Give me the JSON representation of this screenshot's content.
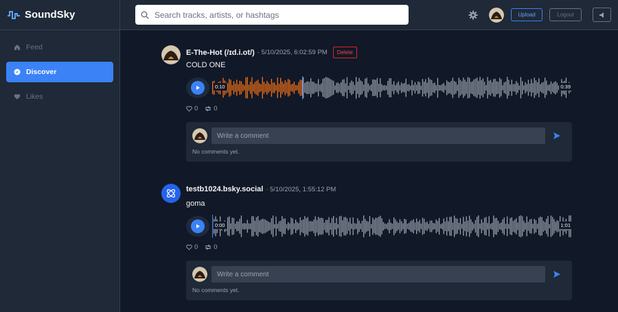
{
  "app": {
    "name": "SoundSky"
  },
  "sidebar": {
    "items": [
      {
        "label": "Feed",
        "icon": "home-icon",
        "active": false
      },
      {
        "label": "Discover",
        "icon": "compass-icon",
        "active": true
      },
      {
        "label": "Likes",
        "icon": "heart-icon",
        "active": false
      }
    ]
  },
  "header": {
    "search_placeholder": "Search tracks, artists, or hashtags",
    "upload_label": "Upload",
    "logout_label": "Logout"
  },
  "posts": [
    {
      "author": "E-The-Hot (/ɪd.i.ot/)",
      "timestamp": "· 5/10/2025, 6:02:59 PM",
      "delete_label": "Delete",
      "title": "COLD ONE",
      "current_time": "0:10",
      "duration": "0:39",
      "progress": 0.25,
      "likes": "0",
      "reposts": "0",
      "comment_placeholder": "Write a comment",
      "comments_empty": "No comments yet."
    },
    {
      "author": "testb1024.bsky.social",
      "timestamp": "· 5/10/2025, 1:55:12 PM",
      "title": "goma",
      "current_time": "0:00",
      "duration": "1:01",
      "progress": 0,
      "likes": "0",
      "reposts": "0",
      "comment_placeholder": "Write a comment",
      "comments_empty": "No comments yet."
    }
  ],
  "colors": {
    "accent": "#3b82f6",
    "wave_played": "#f97316",
    "wave_unplayed": "#9ca3af",
    "danger": "#ef4444"
  }
}
